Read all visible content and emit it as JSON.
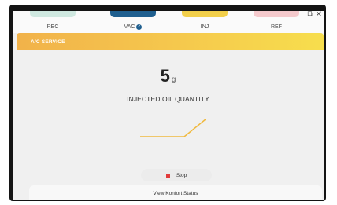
{
  "tabs": [
    {
      "label": "REC",
      "color": "#cfe8e0"
    },
    {
      "label": "VAC",
      "color": "#1f5f8f",
      "done": true
    },
    {
      "label": "INJ",
      "color": "#f2cf4a"
    },
    {
      "label": "REF",
      "color": "#f4c9cc"
    }
  ],
  "window_controls": {
    "popout": "⧉",
    "close": "✕"
  },
  "section": {
    "title": "A/C SERVICE"
  },
  "injection": {
    "value": "5",
    "unit": "g",
    "label": "INJECTED OIL QUANTITY"
  },
  "stop_button": {
    "label": "Stop"
  },
  "status_link": {
    "label": "View Konfort Status"
  },
  "colors": {
    "accent_start": "#f1b24a",
    "accent_end": "#f7de4d",
    "graph": "#f0b93e",
    "stop": "#e23c3c"
  }
}
